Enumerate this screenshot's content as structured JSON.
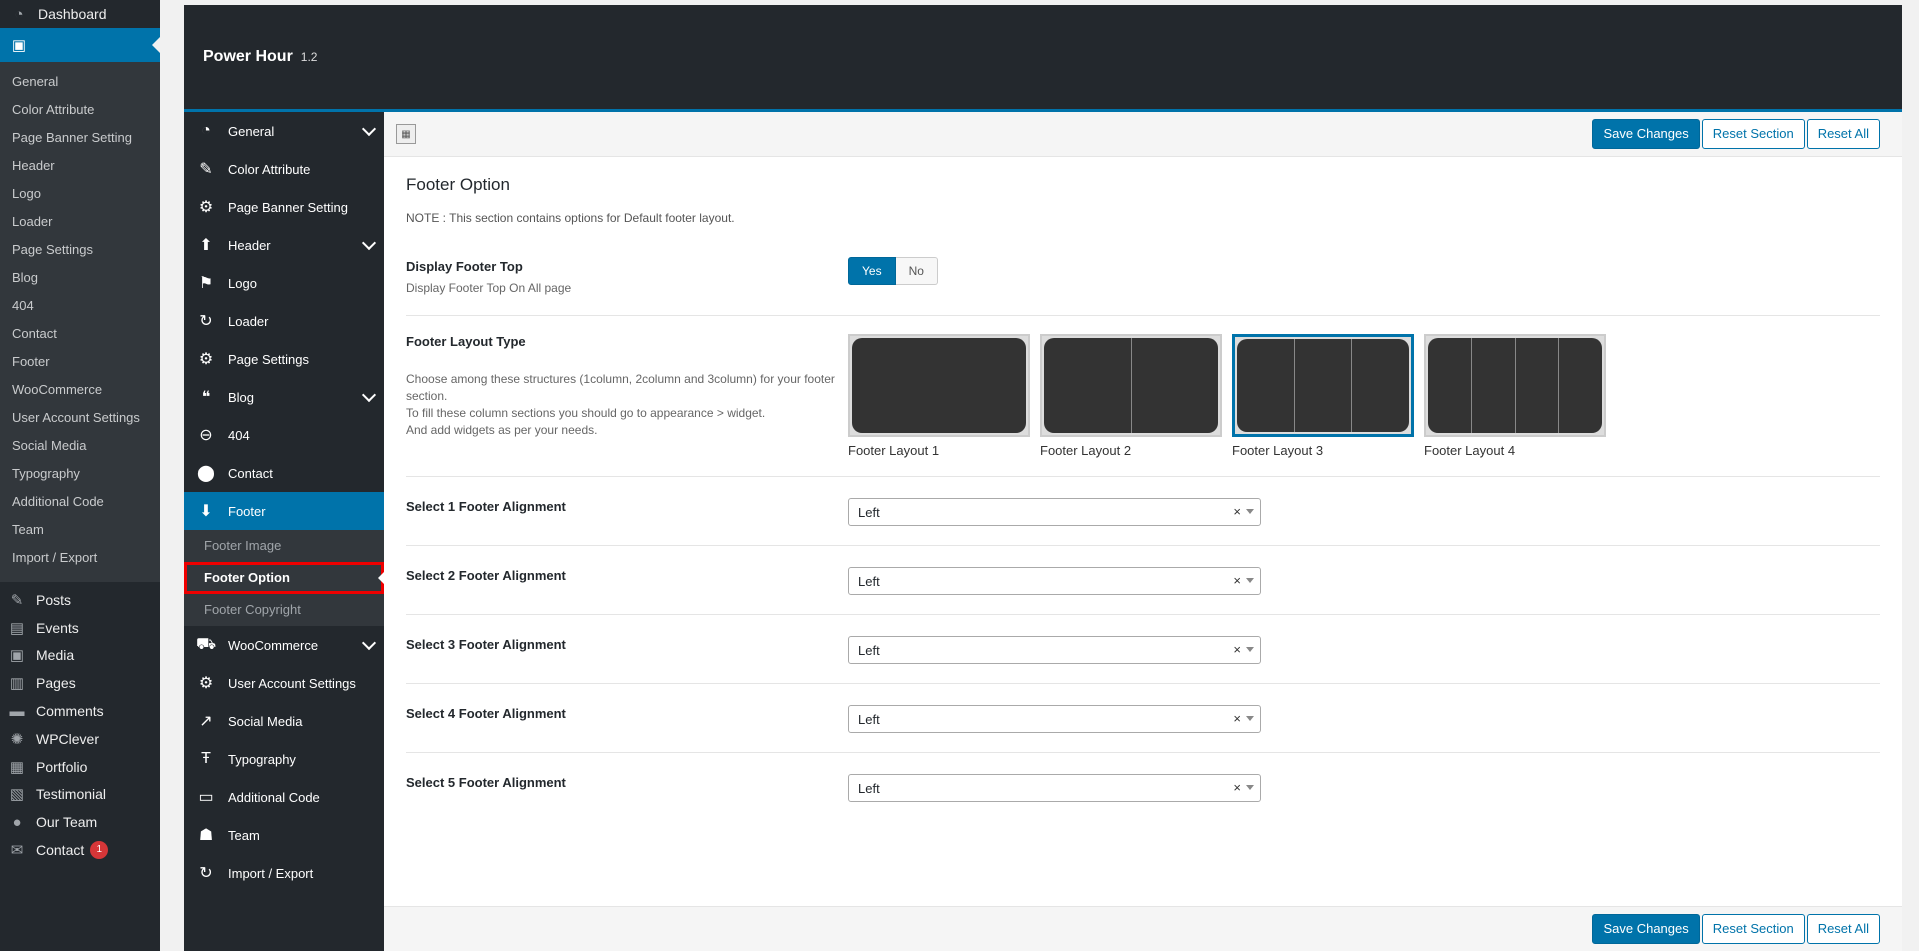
{
  "wp_sidebar": {
    "dashboard": "Dashboard",
    "active_item": "",
    "submenu": [
      "General",
      "Color Attribute",
      "Page Banner Setting",
      "Header",
      "Logo",
      "Loader",
      "Page Settings",
      "Blog",
      "404",
      "Contact",
      "Footer",
      "WooCommerce",
      "User Account Settings",
      "Social Media",
      "Typography",
      "Additional Code",
      "Team",
      "Import / Export"
    ],
    "menu": [
      {
        "label": "Posts",
        "icon": "pushpin-icon"
      },
      {
        "label": "Events",
        "icon": "calendar-icon"
      },
      {
        "label": "Media",
        "icon": "media-icon"
      },
      {
        "label": "Pages",
        "icon": "pages-icon"
      },
      {
        "label": "Comments",
        "icon": "comment-icon"
      },
      {
        "label": "WPClever",
        "icon": "lightbulb-icon"
      },
      {
        "label": "Portfolio",
        "icon": "grid-icon"
      },
      {
        "label": "Testimonial",
        "icon": "testimonial-icon"
      },
      {
        "label": "Our Team",
        "icon": "user-icon"
      },
      {
        "label": "Contact",
        "icon": "mail-icon",
        "badge": "1"
      }
    ]
  },
  "panel": {
    "title": "Power Hour",
    "version": "1.2",
    "menu": [
      {
        "label": "General",
        "icon": "dashboard-icon",
        "chevron": true
      },
      {
        "label": "Color Attribute",
        "icon": "brush-icon"
      },
      {
        "label": "Page Banner Setting",
        "icon": "gear-icon"
      },
      {
        "label": "Header",
        "icon": "arrow-up-icon",
        "chevron": true
      },
      {
        "label": "Logo",
        "icon": "flag-icon"
      },
      {
        "label": "Loader",
        "icon": "refresh-icon"
      },
      {
        "label": "Page Settings",
        "icon": "gear-icon"
      },
      {
        "label": "Blog",
        "icon": "quote-icon",
        "chevron": true
      },
      {
        "label": "404",
        "icon": "minus-circle-icon"
      },
      {
        "label": "Contact",
        "icon": "location-pin-icon"
      },
      {
        "label": "Footer",
        "icon": "arrow-down-icon",
        "active": true
      }
    ],
    "footer_sub": [
      "Footer Image",
      "Footer Option",
      "Footer Copyright"
    ],
    "menu_after": [
      {
        "label": "WooCommerce",
        "icon": "cart-icon",
        "chevron": true
      },
      {
        "label": "User Account Settings",
        "icon": "gear-icon"
      },
      {
        "label": "Social Media",
        "icon": "share-icon"
      },
      {
        "label": "Typography",
        "icon": "typography-icon"
      },
      {
        "label": "Additional Code",
        "icon": "css-icon"
      },
      {
        "label": "Team",
        "icon": "team-icon"
      },
      {
        "label": "Import / Export",
        "icon": "refresh-icon"
      }
    ],
    "buttons": {
      "save": "Save Changes",
      "reset_section": "Reset Section",
      "reset_all": "Reset All"
    }
  },
  "section": {
    "title": "Footer Option",
    "note": "NOTE : This section contains options for Default footer layout.",
    "display_top": {
      "label": "Display Footer Top",
      "desc": "Display Footer Top On All page",
      "yes": "Yes",
      "no": "No",
      "value": "Yes"
    },
    "layout": {
      "label": "Footer Layout Type",
      "desc": [
        "Choose among these structures (1column, 2column and 3column) for your footer section.",
        "To fill these column sections you should go to appearance > widget.",
        "And add widgets as per your needs."
      ],
      "options": [
        "Footer Layout 1",
        "Footer Layout 2",
        "Footer Layout 3",
        "Footer Layout 4"
      ],
      "columns": [
        1,
        2,
        3,
        4
      ],
      "selected": "Footer Layout 3"
    },
    "alignments": [
      {
        "label": "Select 1 Footer Alignment",
        "value": "Left"
      },
      {
        "label": "Select 2 Footer Alignment",
        "value": "Left"
      },
      {
        "label": "Select 3 Footer Alignment",
        "value": "Left"
      },
      {
        "label": "Select 4 Footer Alignment",
        "value": "Left"
      },
      {
        "label": "Select 5 Footer Alignment",
        "value": "Left"
      }
    ]
  }
}
